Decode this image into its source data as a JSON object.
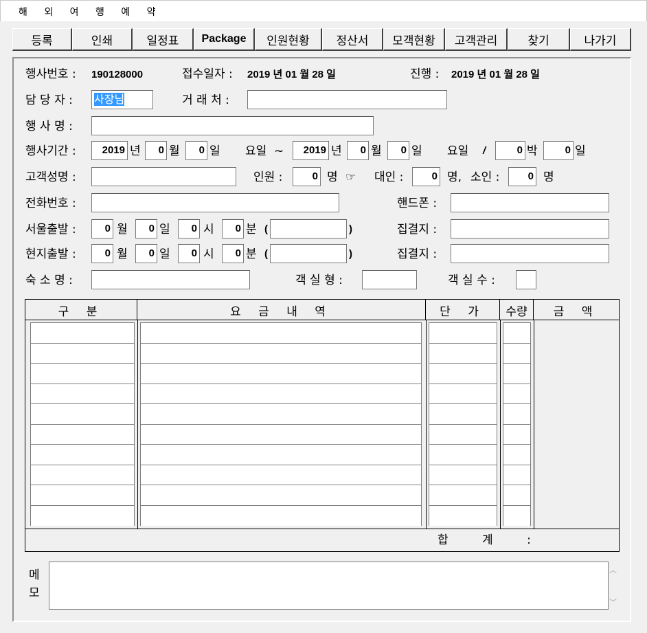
{
  "window": {
    "title": "해 외 여 행 예 약"
  },
  "toolbar": {
    "tabs": [
      {
        "label": "등록"
      },
      {
        "label": "인쇄"
      },
      {
        "label": "일정표"
      },
      {
        "label": "Package"
      },
      {
        "label": "인원현황"
      },
      {
        "label": "정산서"
      },
      {
        "label": "모객현황"
      },
      {
        "label": "고객관리"
      },
      {
        "label": "찾기"
      },
      {
        "label": "나가기"
      }
    ]
  },
  "header": {
    "event_no_label": "행사번호 :",
    "event_no": "190128000",
    "receipt_label": "접수일자 :",
    "receipt_date": "2019 년 01 월 28 일",
    "progress_label": "진행 :",
    "progress_date": "2019 년 01 월 28 일"
  },
  "form": {
    "manager_label": "담 당 자 :",
    "manager_value": "사장님",
    "client_label": "거 래 처 :",
    "client_value": "",
    "event_name_label": "행 사 명 :",
    "event_name_value": "",
    "period_label": "행사기간 :",
    "start_year": "2019",
    "start_month": "0",
    "start_day": "0",
    "year_unit": "년",
    "month_unit": "월",
    "day_unit": "일",
    "weekday_label": "요일",
    "tilde": "~",
    "end_year": "2019",
    "end_month": "0",
    "end_day": "0",
    "slash": "/",
    "nights": "0",
    "nights_unit": "박",
    "days": "0",
    "customer_label": "고객성명 :",
    "customer_value": "",
    "people_label": "인원 :",
    "people_value": "0",
    "person_unit": "명",
    "pointer": "☞",
    "adult_label": "대인 :",
    "adult_value": "0",
    "adult_unit": "명,",
    "child_label": "소인 :",
    "child_value": "0",
    "phone_label": "전화번호 :",
    "phone_value": "",
    "mobile_label": "핸드폰 :",
    "mobile_value": "",
    "seoul_dep_label": "서울출발 :",
    "seoul_month": "0",
    "seoul_day": "0",
    "seoul_hour": "0",
    "seoul_min": "0",
    "hour_unit": "시",
    "min_unit": "분",
    "paren_open": "(",
    "paren_close": ")",
    "seoul_note": "",
    "meeting_label": "집결지 :",
    "seoul_meeting": "",
    "local_dep_label": "현지출발 :",
    "local_month": "0",
    "local_day": "0",
    "local_hour": "0",
    "local_min": "0",
    "local_note": "",
    "local_meeting": "",
    "hotel_label": "숙 소 명 :",
    "hotel_value": "",
    "room_type_label": "객 실 형 :",
    "room_type_value": "",
    "room_count_label": "객 실 수 :",
    "room_count_value": ""
  },
  "grid": {
    "headers": [
      "구 분",
      "요 금 내 역",
      "단 가",
      "수량",
      "금 액"
    ],
    "rows": 10,
    "total_label": "합 계 :"
  },
  "memo": {
    "label_1": "메",
    "label_2": "모",
    "value": ""
  }
}
